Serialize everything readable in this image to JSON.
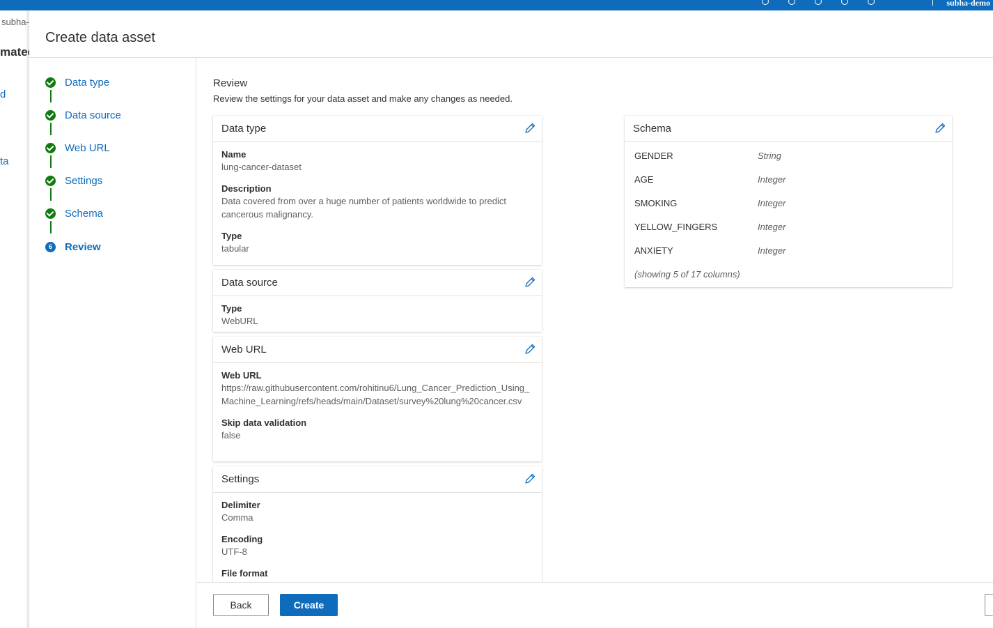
{
  "topbar": {
    "user": "subha-demo"
  },
  "background": {
    "breadcrumb": "subha-",
    "title_fragment": "mated",
    "link1": "d",
    "link2": "ta"
  },
  "panel": {
    "title": "Create data asset"
  },
  "steps": [
    {
      "label": "Data type",
      "status": "complete"
    },
    {
      "label": "Data source",
      "status": "complete"
    },
    {
      "label": "Web URL",
      "status": "complete"
    },
    {
      "label": "Settings",
      "status": "complete"
    },
    {
      "label": "Schema",
      "status": "complete"
    },
    {
      "label": "Review",
      "status": "current",
      "number": "6"
    }
  ],
  "review": {
    "title": "Review",
    "subtitle": "Review the settings for your data asset and make any changes as needed."
  },
  "cards": {
    "data_type": {
      "title": "Data type",
      "fields": [
        {
          "label": "Name",
          "value": "lung-cancer-dataset"
        },
        {
          "label": "Description",
          "value": "Data covered from over a huge number of patients worldwide to predict cancerous malignancy."
        },
        {
          "label": "Type",
          "value": "tabular"
        }
      ]
    },
    "data_source": {
      "title": "Data source",
      "fields": [
        {
          "label": "Type",
          "value": "WebURL"
        }
      ]
    },
    "web_url": {
      "title": "Web URL",
      "fields": [
        {
          "label": "Web URL",
          "value": "https://raw.githubusercontent.com/rohitinu6/Lung_Cancer_Prediction_Using_Machine_Learning/refs/heads/main/Dataset/survey%20lung%20cancer.csv"
        },
        {
          "label": "Skip data validation",
          "value": "false"
        }
      ]
    },
    "settings": {
      "title": "Settings",
      "fields": [
        {
          "label": "Delimiter",
          "value": "Comma"
        },
        {
          "label": "Encoding",
          "value": "UTF-8"
        },
        {
          "label": "File format",
          "value": ""
        }
      ]
    },
    "schema": {
      "title": "Schema",
      "columns": [
        {
          "name": "GENDER",
          "type": "String"
        },
        {
          "name": "AGE",
          "type": "Integer"
        },
        {
          "name": "SMOKING",
          "type": "Integer"
        },
        {
          "name": "YELLOW_FINGERS",
          "type": "Integer"
        },
        {
          "name": "ANXIETY",
          "type": "Integer"
        }
      ],
      "note": "(showing 5 of 17 columns)"
    }
  },
  "footer": {
    "back_label": "Back",
    "create_label": "Create"
  },
  "colors": {
    "accent": "#0f6cbd",
    "success": "#107c10"
  }
}
